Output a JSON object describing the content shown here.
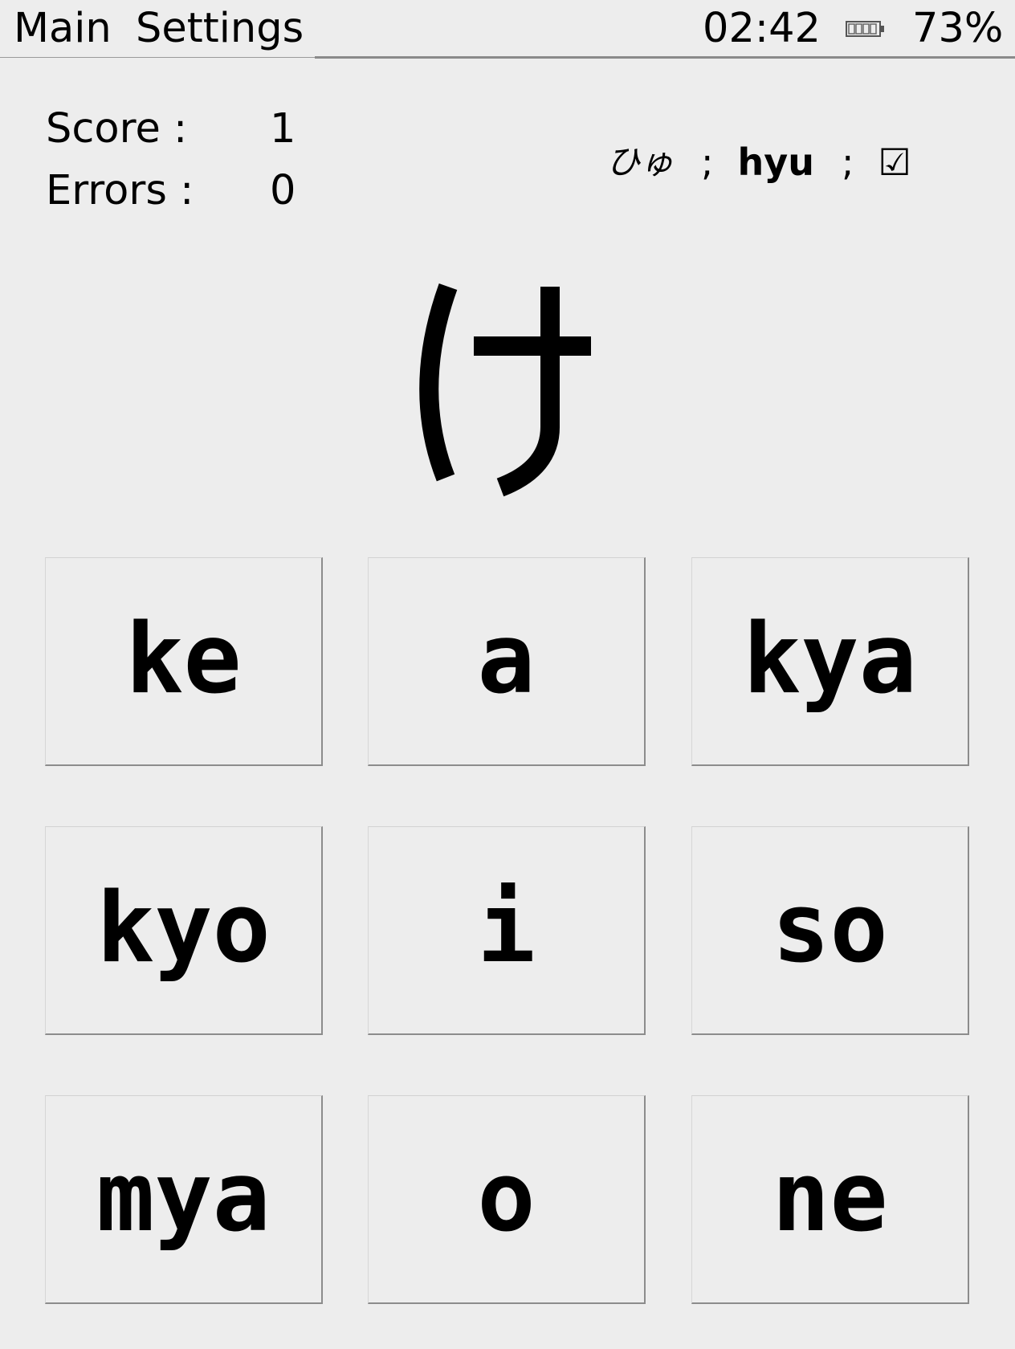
{
  "header": {
    "menu": [
      {
        "label": "Main"
      },
      {
        "label": "Settings"
      }
    ],
    "clock": "02:42",
    "battery": {
      "icon": "battery-icon",
      "percent_label": "73%",
      "level": 0.73
    }
  },
  "stats": {
    "score_label": "Score :",
    "score_value": "1",
    "errors_label": "Errors :",
    "errors_value": "0"
  },
  "last_answer": {
    "kana": "ひゅ",
    "separator": ";",
    "romaji": "hyu",
    "result_icon": "☑"
  },
  "question": {
    "kana": "け"
  },
  "answers": [
    {
      "label": "ke"
    },
    {
      "label": "a"
    },
    {
      "label": "kya"
    },
    {
      "label": "kyo"
    },
    {
      "label": "i"
    },
    {
      "label": "so"
    },
    {
      "label": "mya"
    },
    {
      "label": "o"
    },
    {
      "label": "ne"
    }
  ]
}
